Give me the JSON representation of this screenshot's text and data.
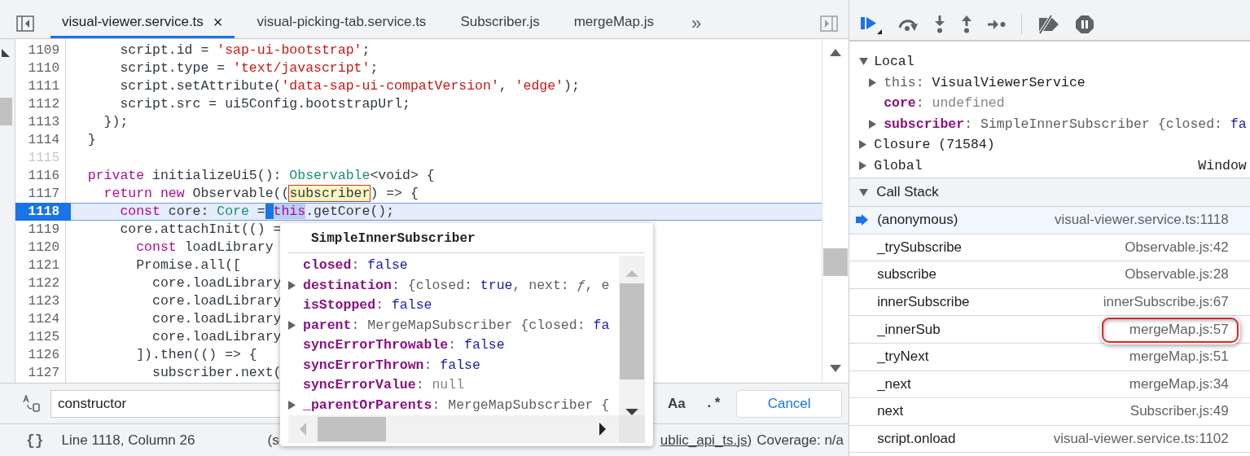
{
  "tabs": [
    {
      "label": "visual-viewer.service.ts",
      "selected": true,
      "close": "×"
    },
    {
      "label": "visual-picking-tab.service.ts",
      "selected": false
    },
    {
      "label": "Subscriber.js",
      "selected": false
    },
    {
      "label": "mergeMap.js",
      "selected": false
    }
  ],
  "more_tabs": "»",
  "lines": [
    {
      "number": "1109",
      "current": false,
      "dimmed": false,
      "tokens": [
        {
          "text": "      script.id = ",
          "kind": "plain"
        },
        {
          "text": "'sap-ui-bootstrap'",
          "kind": "string"
        },
        {
          "text": ";",
          "kind": "plain"
        }
      ]
    },
    {
      "number": "1110",
      "current": false,
      "dimmed": false,
      "tokens": [
        {
          "text": "      script.type = ",
          "kind": "plain"
        },
        {
          "text": "'text/javascript'",
          "kind": "string"
        },
        {
          "text": ";",
          "kind": "plain"
        }
      ]
    },
    {
      "number": "1111",
      "current": false,
      "dimmed": false,
      "tokens": [
        {
          "text": "      script.setAttribute(",
          "kind": "plain"
        },
        {
          "text": "'data-sap-ui-compatVersion'",
          "kind": "string"
        },
        {
          "text": ", ",
          "kind": "plain"
        },
        {
          "text": "'edge'",
          "kind": "string"
        },
        {
          "text": ");",
          "kind": "plain"
        }
      ]
    },
    {
      "number": "1112",
      "current": false,
      "dimmed": false,
      "tokens": [
        {
          "text": "      script.src = ui5Config.bootstrapUrl;",
          "kind": "plain"
        }
      ]
    },
    {
      "number": "1113",
      "current": false,
      "dimmed": false,
      "tokens": [
        {
          "text": "    });",
          "kind": "plain"
        }
      ]
    },
    {
      "number": "1114",
      "current": false,
      "dimmed": false,
      "tokens": [
        {
          "text": "  }",
          "kind": "plain"
        }
      ]
    },
    {
      "number": "1115",
      "current": false,
      "dimmed": true
    },
    {
      "number": "1116",
      "current": false,
      "dimmed": false,
      "tokens": [
        {
          "text": "  private",
          "kind": "keyword"
        },
        {
          "text": " initializeUi5(): ",
          "kind": "plain"
        },
        {
          "text": "Observable",
          "kind": "type"
        },
        {
          "text": "<void> {",
          "kind": "plain"
        }
      ]
    },
    {
      "number": "1117",
      "current": false,
      "dimmed": false,
      "tokens": [
        {
          "text": "    return",
          "kind": "keyword"
        },
        {
          "text": " new",
          "kind": "keyword"
        },
        {
          "text": " Observable((",
          "kind": "plain"
        },
        {
          "text": "subscriber",
          "kind": "hovered"
        },
        {
          "text": ") => {",
          "kind": "plain"
        }
      ]
    },
    {
      "number": "1118",
      "current": true,
      "dimmed": false,
      "tokens": [
        {
          "text": "      const",
          "kind": "keyword"
        },
        {
          "text": " core: ",
          "kind": "plain"
        },
        {
          "text": "Core",
          "kind": "type"
        },
        {
          "text": " = ",
          "kind": "plain"
        },
        {
          "text": "this",
          "kind": "selection"
        },
        {
          "text": ".getCore();",
          "kind": "plain"
        }
      ]
    },
    {
      "number": "1119",
      "current": false,
      "dimmed": false,
      "tokens": [
        {
          "text": "      core.attachInit(() =",
          "kind": "plain"
        }
      ]
    },
    {
      "number": "1120",
      "current": false,
      "dimmed": false,
      "tokens": [
        {
          "text": "        const",
          "kind": "keyword"
        },
        {
          "text": " loadLibrary",
          "kind": "plain"
        }
      ]
    },
    {
      "number": "1121",
      "current": false,
      "dimmed": false,
      "tokens": [
        {
          "text": "        Promise.all([",
          "kind": "plain"
        }
      ]
    },
    {
      "number": "1122",
      "current": false,
      "dimmed": false,
      "tokens": [
        {
          "text": "          core.loadLibrary",
          "kind": "plain"
        }
      ]
    },
    {
      "number": "1123",
      "current": false,
      "dimmed": false,
      "tokens": [
        {
          "text": "          core.loadLibrary",
          "kind": "plain"
        }
      ]
    },
    {
      "number": "1124",
      "current": false,
      "dimmed": false,
      "tokens": [
        {
          "text": "          core.loadLibrary",
          "kind": "plain"
        }
      ]
    },
    {
      "number": "1125",
      "current": false,
      "dimmed": false,
      "tokens": [
        {
          "text": "          core.loadLibrary",
          "kind": "plain"
        }
      ]
    },
    {
      "number": "1126",
      "current": false,
      "dimmed": false,
      "tokens": [
        {
          "text": "        ]).then(() => {",
          "kind": "plain"
        }
      ]
    },
    {
      "number": "1127",
      "current": false,
      "dimmed": false,
      "tokens": [
        {
          "text": "          subscriber.next(",
          "kind": "plain"
        }
      ]
    }
  ],
  "popover": {
    "title": "SimpleInnerSubscriber",
    "rows": [
      {
        "key": "closed",
        "kind": "primitive",
        "value": [
          {
            "text": ": ",
            "kind": "plain"
          },
          {
            "text": "false",
            "kind": "bool"
          }
        ]
      },
      {
        "key": "destination",
        "kind": "object",
        "expanded": false,
        "value": [
          {
            "text": ": {closed: ",
            "kind": "plain"
          },
          {
            "text": "true",
            "kind": "bool"
          },
          {
            "text": ", next: ",
            "kind": "plain"
          },
          {
            "text": "ƒ",
            "kind": "func"
          },
          {
            "text": ", e",
            "kind": "plain"
          }
        ]
      },
      {
        "key": "isStopped",
        "kind": "primitive",
        "value": [
          {
            "text": ": ",
            "kind": "plain"
          },
          {
            "text": "false",
            "kind": "bool"
          }
        ]
      },
      {
        "key": "parent",
        "kind": "object",
        "expanded": false,
        "value": [
          {
            "text": ": MergeMapSubscriber {closed: ",
            "kind": "plain"
          },
          {
            "text": "fa",
            "kind": "bool"
          }
        ]
      },
      {
        "key": "syncErrorThrowable",
        "kind": "primitive",
        "value": [
          {
            "text": ": ",
            "kind": "plain"
          },
          {
            "text": "false",
            "kind": "bool"
          }
        ]
      },
      {
        "key": "syncErrorThrown",
        "kind": "primitive",
        "value": [
          {
            "text": ": ",
            "kind": "plain"
          },
          {
            "text": "false",
            "kind": "bool"
          }
        ]
      },
      {
        "key": "syncErrorValue",
        "kind": "primitive",
        "value": [
          {
            "text": ": ",
            "kind": "plain"
          },
          {
            "text": "null",
            "kind": "null"
          }
        ]
      },
      {
        "key": "_parentOrParents",
        "kind": "object",
        "expanded": false,
        "value": [
          {
            "text": ": MergeMapSubscriber {",
            "kind": "plain"
          }
        ]
      }
    ]
  },
  "search": {
    "value": "constructor",
    "match_case": "Aa",
    "regex": ".*",
    "cancel": "Cancel"
  },
  "status_bar": {
    "format": "{}",
    "position": "Line 1118, Column 26",
    "source_start": "(s",
    "source_end": "ublic_api_ts.js)",
    "coverage": "Coverage: n/a"
  },
  "scope": [
    {
      "label": "Local",
      "expanded": true,
      "children": [
        {
          "key": "this",
          "kind": "receiver",
          "expanded": false,
          "value": [
            {
              "text": ": ",
              "kind": "plain"
            },
            {
              "text": "VisualViewerService",
              "kind": "object"
            }
          ]
        },
        {
          "key": "core",
          "kind": "primitive",
          "value": [
            {
              "text": ": ",
              "kind": "plain"
            },
            {
              "text": "undefined",
              "kind": "null"
            }
          ]
        },
        {
          "key": "subscriber",
          "kind": "object",
          "expanded": false,
          "value": [
            {
              "text": ": SimpleInnerSubscriber {closed: ",
              "kind": "plain"
            },
            {
              "text": "fa",
              "kind": "bool"
            }
          ]
        }
      ]
    },
    {
      "label": "Closure (71584)",
      "expanded": false
    },
    {
      "label": "Global",
      "expanded": false,
      "value": "Window"
    }
  ],
  "call_stack": {
    "title": "Call Stack",
    "expanded": true,
    "frames": [
      {
        "function": "(anonymous)",
        "location": "visual-viewer.service.ts:1118",
        "selected": true,
        "outlined": false
      },
      {
        "function": "_trySubscribe",
        "location": "Observable.js:42",
        "selected": false,
        "outlined": false
      },
      {
        "function": "subscribe",
        "location": "Observable.js:28",
        "selected": false,
        "outlined": false
      },
      {
        "function": "innerSubscribe",
        "location": "innerSubscribe.js:67",
        "selected": false,
        "outlined": false
      },
      {
        "function": "_innerSub",
        "location": "mergeMap.js:57",
        "selected": false,
        "outlined": true
      },
      {
        "function": "_tryNext",
        "location": "mergeMap.js:51",
        "selected": false,
        "outlined": false
      },
      {
        "function": "_next",
        "location": "mergeMap.js:34",
        "selected": false,
        "outlined": false
      },
      {
        "function": "next",
        "location": "Subscriber.js:49",
        "selected": false,
        "outlined": false
      },
      {
        "function": "script.onload",
        "location": "visual-viewer.service.ts:1102",
        "selected": false,
        "outlined": false
      }
    ]
  }
}
